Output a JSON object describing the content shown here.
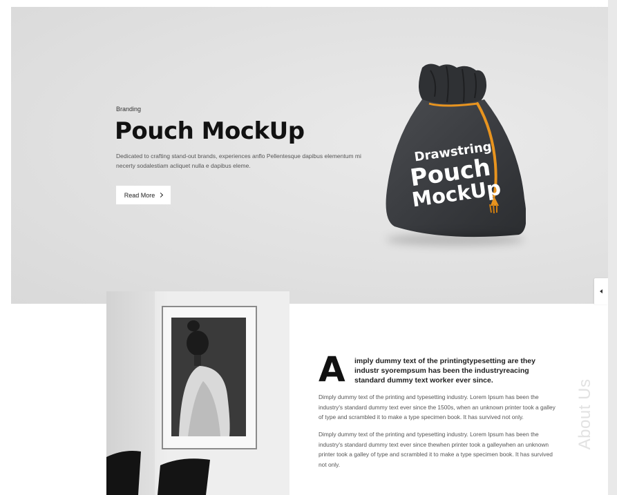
{
  "hero": {
    "kicker": "Branding",
    "title": "Pouch MockUp",
    "description": "Dedicated to crafting stand-out brands, experiences anflo Pellentesque dapibus elementum mi necerty sodalestiam acliquet nulla e dapibus eleme.",
    "read_more_label": "Read More",
    "pouch_print": [
      "Drawstring",
      "Pouch",
      "MockUp"
    ]
  },
  "about": {
    "dropcap": "A",
    "lead": "imply dummy text of the printingtypesetting are they industr syorempsum has been the industryreacing standard dummy text worker ever since.",
    "paragraph_1": "Dimply dummy text of the printing and typesetting industry. Lorem Ipsum has been the industry's standard dummy text ever since the 1500s, when an unknown printer took a galley of type and scrambled it to make a type specimen book. It has survived not only.",
    "paragraph_2": "Dimply dummy text of the printing and typesetting industry. Lorem Ipsum has been the industry's standard dummy text ever since thewhen printer took a galleywhen an unknown printer took a galley of type and scrambled it to make a type specimen book. It has survived not only.",
    "vertical_label": "About Us"
  },
  "colors": {
    "hero_bg": "#e1e1e1",
    "pouch": "#3b3d40",
    "drawstring": "#e8941f",
    "text_dark": "#111111"
  }
}
